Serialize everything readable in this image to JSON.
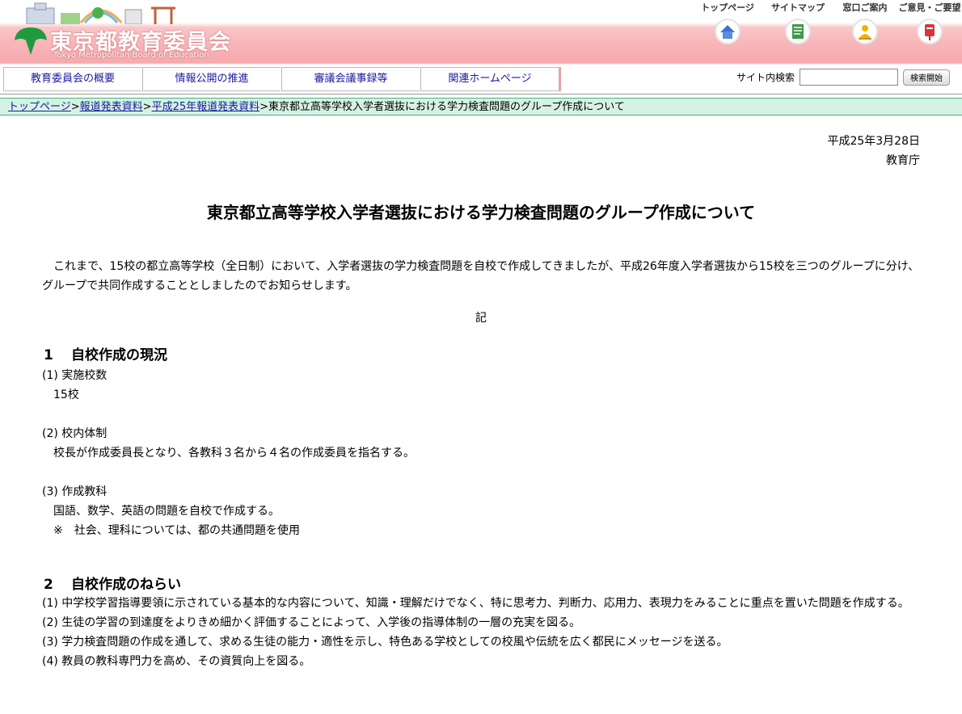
{
  "header": {
    "title": "東京都教育委員会",
    "subtitle": "Tokyo Metropolitan Board of Education",
    "top_links": [
      {
        "label": "トップページ",
        "icon": "home-icon"
      },
      {
        "label": "サイトマップ",
        "icon": "document-icon"
      },
      {
        "label": "窓口ご案内",
        "icon": "person-icon"
      },
      {
        "label": "ご意見・ご要望",
        "icon": "postbox-icon"
      }
    ]
  },
  "nav": {
    "items": [
      "教育委員会の概要",
      "情報公開の推進",
      "審議会議事録等",
      "関連ホームページ"
    ]
  },
  "search": {
    "label": "サイト内検索",
    "value": "",
    "button": "検索開始"
  },
  "breadcrumb": {
    "links": [
      "トップページ",
      "報道発表資料",
      "平成25年報道発表資料"
    ],
    "separator": ">",
    "current": "東京都立高等学校入学者選抜における学力検査問題のグループ作成について"
  },
  "doc": {
    "date": "平成25年3月28日",
    "issuer": "教育庁",
    "title": "東京都立高等学校入学者選抜における学力検査問題のグループ作成について",
    "intro": "これまで、15校の都立高等学校（全日制）において、入学者選抜の学力検査問題を自校で作成してきましたが、平成26年度入学者選抜から15校を三つのグループに分け、グループで共同作成することとしましたのでお知らせします。",
    "ki": "記",
    "section1": {
      "num": "1",
      "heading": "自校作成の現況",
      "items": [
        {
          "label": "(1) 実施校数",
          "body": "15校"
        },
        {
          "label": "(2) 校内体制",
          "body": "校長が作成委員長となり、各教科３名から４名の作成委員を指名する。"
        },
        {
          "label": "(3) 作成教科",
          "body": "国語、数学、英語の問題を自校で作成する。",
          "note": "※　社会、理科については、都の共通問題を使用"
        }
      ]
    },
    "section2": {
      "num": "2",
      "heading": "自校作成のねらい",
      "items": [
        "(1) 中学校学習指導要領に示されている基本的な内容について、知識・理解だけでなく、特に思考力、判断力、応用力、表現力をみることに重点を置いた問題を作成する。",
        "(2) 生徒の学習の到達度をよりきめ細かく評価することによって、入学後の指導体制の一層の充実を図る。",
        "(3) 学力検査問題の作成を通して、求める生徒の能力・適性を示し、特色ある学校としての校風や伝統を広く都民にメッセージを送る。",
        "(4) 教員の教科専門力を高め、その資質向上を図る。"
      ]
    }
  },
  "colors": {
    "header_pink": "#f6a9ad",
    "logo_green": "#1f9a3e",
    "link_blue": "#1a1a9c",
    "breadcrumb_bg": "#d6f2e4"
  }
}
